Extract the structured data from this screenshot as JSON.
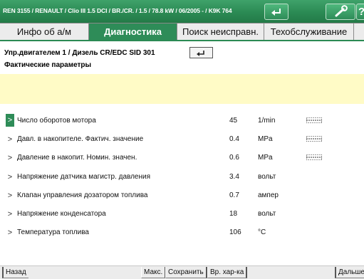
{
  "title_bar": {
    "vehicle_info": "REN 3155 / RENAULT / Clio III 1.5 DCI / BR./CR. / 1.5 / 78.8 kW / 06/2005 -  / K9K 764"
  },
  "tabs": [
    {
      "label": "Инфо об а/м",
      "active": false
    },
    {
      "label": "Диагностика",
      "active": true
    },
    {
      "label": "Поиск неисправн.",
      "active": false
    },
    {
      "label": "Техобслуживание",
      "active": false
    }
  ],
  "header": {
    "subtitle": "Упр.двигателем 1 / Дизель CR/EDC SID 301",
    "section": "Фактические параметры"
  },
  "parameters": [
    {
      "label": "Число оборотов мотора",
      "value": "45",
      "unit": "1/min",
      "graph": true,
      "selected": true
    },
    {
      "label": "Давл. в накопителе. Фактич. значение",
      "value": "0.4",
      "unit": "MPa",
      "graph": true,
      "selected": false
    },
    {
      "label": "Давление в накопит. Номин. значен.",
      "value": "0.6",
      "unit": "MPa",
      "graph": true,
      "selected": false
    },
    {
      "label": "Напряжение датчика магистр. давления",
      "value": "3.4",
      "unit": "вольт",
      "graph": false,
      "selected": false
    },
    {
      "label": "Клапан управления дозатором топлива",
      "value": "0.7",
      "unit": "ампер",
      "graph": false,
      "selected": false
    },
    {
      "label": "Напряжение конденсатора",
      "value": "18",
      "unit": "вольт",
      "graph": false,
      "selected": false
    },
    {
      "label": "Температура топлива",
      "value": "106",
      "unit": "°C",
      "graph": false,
      "selected": false
    }
  ],
  "row_marker": ">",
  "bottom_bar": {
    "back": "Назад",
    "max": "Макс.",
    "save": "Сохранить",
    "time_chart": "Вр. хар-ка",
    "next": "Дальше"
  },
  "colors": {
    "accent_green": "#2e8c58",
    "message_band": "#fffbc6"
  },
  "icons": {
    "back": "back-arrow-icon",
    "tools": "wrench-icon",
    "help": "question-mark-icon",
    "graph": "mini-graph-icon"
  }
}
